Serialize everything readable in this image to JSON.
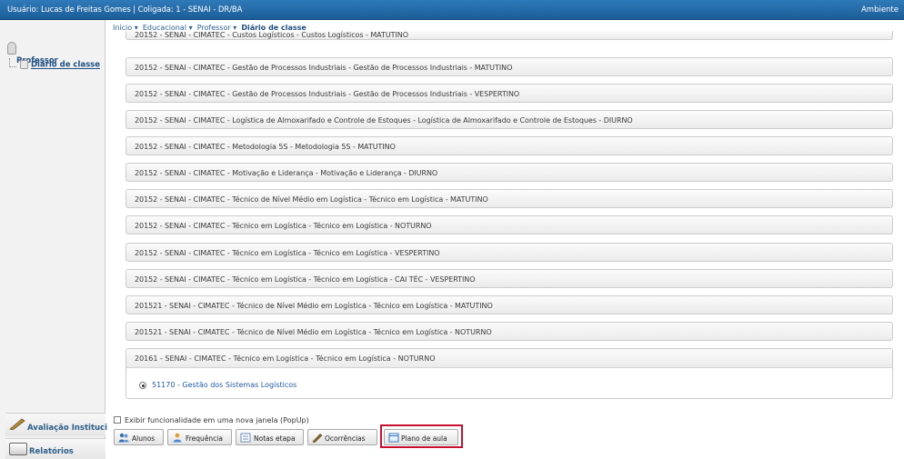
{
  "topbar": {
    "user_info": "Usuário: Lucas de Freitas Gomes  |  Coligada: 1 - SENAI - DR/BA",
    "environment": "Ambiente"
  },
  "sidebar": {
    "section": "Professor",
    "item": "Diário de classe",
    "bottom1": "Avaliação Instituci",
    "bottom2": "Relatórios"
  },
  "breadcrumb": {
    "inicio": "Início ▾",
    "educacional": "Educacional ▾",
    "professor": "Professor ▾",
    "current": "Diário de classe"
  },
  "classes": {
    "cut_row": "20152 - SENAI - CIMATEC - Custos Logísticos - Custos Logísticos - MATUTINO",
    "rows": [
      "20152 - SENAI - CIMATEC - Gestão de Processos Industriais - Gestão de Processos Industriais - MATUTINO",
      "20152 - SENAI - CIMATEC - Gestão de Processos Industriais - Gestão de Processos Industriais - VESPERTINO",
      "20152 - SENAI - CIMATEC - Logística de Almoxarifado e Controle de Estoques - Logística de Almoxarifado e Controle de Estoques - DIURNO",
      "20152 - SENAI - CIMATEC - Metodologia 5S - Metodologia 5S - MATUTINO",
      "20152 - SENAI - CIMATEC - Motivação e Liderança - Motivação e Liderança - DIURNO",
      "20152 - SENAI - CIMATEC - Técnico de Nível Médio em Logística - Técnico em Logística - MATUTINO",
      "20152 - SENAI - CIMATEC - Técnico em Logística - Técnico em Logística - NOTURNO",
      "20152 - SENAI - CIMATEC - Técnico em Logística - Técnico em Logística  - VESPERTINO",
      "20152 - SENAI - CIMATEC - Técnico em Logística - Técnico em Logística - CAI TÉC - VESPERTINO",
      "201521 - SENAI - CIMATEC - Técnico de Nível Médio em Logística - Técnico em Logística - MATUTINO",
      "201521 - SENAI - CIMATEC - Técnico de Nível Médio em Logística - Técnico em Logística - NOTURNO"
    ],
    "expanded_header": "20161 - SENAI - CIMATEC - Técnico em Logística - Técnico em Logística - NOTURNO",
    "expanded_subject": "51170 - Gestão dos Sistemas Logísticos"
  },
  "footer": {
    "popup_label": "Exibir funcionalidade em uma nova janela (PopUp)",
    "buttons": {
      "alunos": "Alunos",
      "frequencia": "Frequência",
      "notas": "Notas etapa",
      "ocorrencias": "Ocorrências",
      "plano": "Plano de aula"
    }
  },
  "colors": {
    "topbar": "#1b5e98",
    "highlight": "#c8102e",
    "link": "#2459a2"
  }
}
